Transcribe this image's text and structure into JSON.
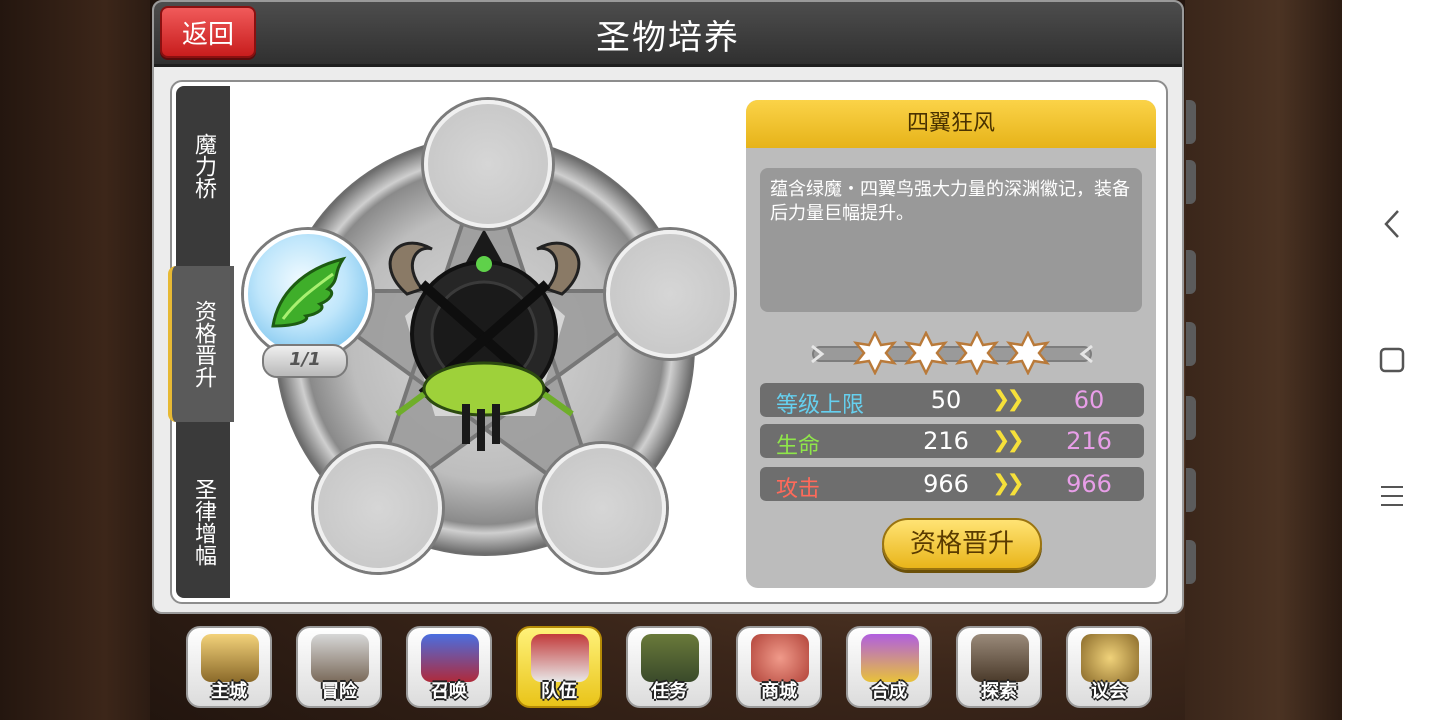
{
  "header": {
    "title": "圣物培养",
    "back_label": "返回"
  },
  "side_tabs": [
    {
      "label": "魔力桥",
      "active": false
    },
    {
      "label": "资格晋升",
      "active": true
    },
    {
      "label": "圣律增幅",
      "active": false
    }
  ],
  "relic_slots": {
    "filled_count": "1/1"
  },
  "info": {
    "name": "四翼狂风",
    "description": "蕴含绿魔・四翼鸟强大力量的深渊徽记，装备后力量巨幅提升。",
    "stars": 4,
    "stats": [
      {
        "label": "等级上限",
        "from": "50",
        "arrow": "»",
        "to": "60",
        "color": "#66d0ef"
      },
      {
        "label": "生命",
        "from": "216",
        "arrow": "»",
        "to": "216",
        "color": "#8fe64a"
      },
      {
        "label": "攻击",
        "from": "966",
        "arrow": "»",
        "to": "966",
        "color": "#ff6a5a"
      }
    ],
    "upgrade_label": "资格晋升"
  },
  "dock": [
    {
      "label": "主城",
      "icon": "crown-castle-icon"
    },
    {
      "label": "冒险",
      "icon": "crossed-swords-icon"
    },
    {
      "label": "召唤",
      "icon": "summon-card-icon"
    },
    {
      "label": "队伍",
      "icon": "winged-crest-icon",
      "active": true
    },
    {
      "label": "任务",
      "icon": "quest-book-icon"
    },
    {
      "label": "商城",
      "icon": "shop-tree-icon"
    },
    {
      "label": "合成",
      "icon": "potion-flask-icon"
    },
    {
      "label": "探索",
      "icon": "pickaxe-shovel-icon"
    },
    {
      "label": "议会",
      "icon": "council-emblem-icon"
    }
  ],
  "system_nav": {
    "back": "back-icon",
    "home": "home-square-icon",
    "menu": "menu-lines-icon"
  }
}
